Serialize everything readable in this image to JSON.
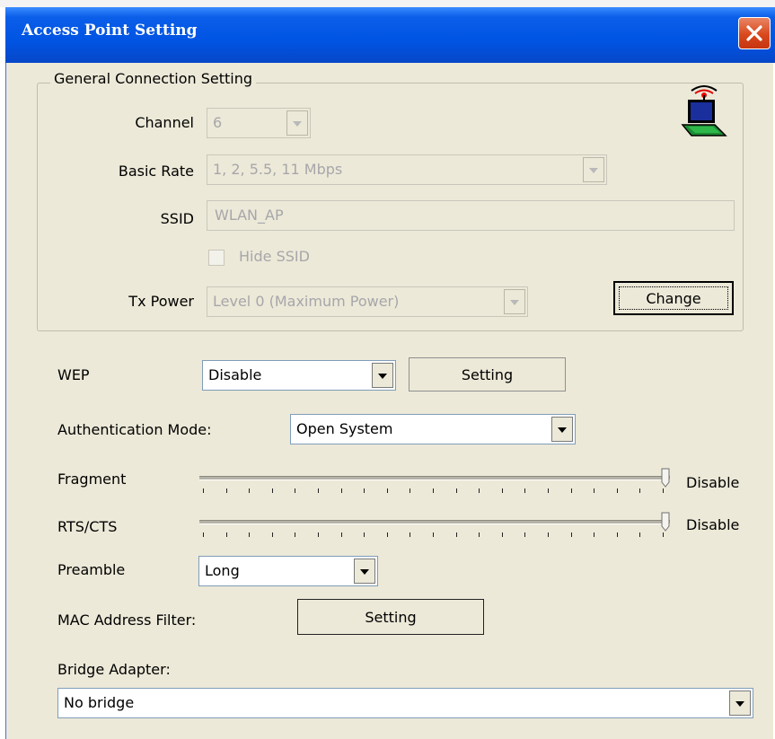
{
  "window": {
    "title": "Access Point Setting"
  },
  "general": {
    "group_title": "General Connection Setting",
    "channel_label": "Channel",
    "channel_value": "6",
    "basic_rate_label": "Basic Rate",
    "basic_rate_value": "1, 2, 5.5, 11 Mbps",
    "ssid_label": "SSID",
    "ssid_value": "WLAN_AP",
    "hide_ssid_label": "Hide SSID",
    "hide_ssid_checked": false,
    "tx_power_label": "Tx Power",
    "tx_power_value": "Level 0 (Maximum Power)",
    "change_label": "Change"
  },
  "wep": {
    "label": "WEP",
    "value": "Disable",
    "setting_label": "Setting"
  },
  "auth": {
    "label": "Authentication Mode:",
    "value": "Open System"
  },
  "fragment": {
    "label": "Fragment",
    "value_text": "Disable",
    "level": 1.0
  },
  "rts": {
    "label": "RTS/CTS",
    "value_text": "Disable",
    "level": 1.0
  },
  "preamble": {
    "label": "Preamble",
    "value": "Long"
  },
  "mac_filter": {
    "label": "MAC Address Filter:",
    "setting_label": "Setting"
  },
  "bridge": {
    "label": "Bridge Adapter:",
    "value": "No bridge"
  },
  "colors": {
    "titlebar": "#0054e3",
    "dialog_bg": "#ece9d8",
    "close_button": "#d9481c"
  },
  "icons": {
    "close": "close-icon",
    "adapter": "laptop-wireless-icon",
    "dropdown": "chevron-down-icon"
  }
}
